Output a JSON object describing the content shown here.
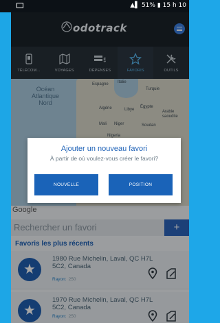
{
  "status_bar": {
    "battery": "51%",
    "time": "15 h 10"
  },
  "app": {
    "name": "odotrack"
  },
  "tabs": [
    {
      "label": "TÉLÉCOM..."
    },
    {
      "label": "VOYAGES"
    },
    {
      "label": "DÉPENSES"
    },
    {
      "label": "FAVORIS"
    },
    {
      "label": "OUTILS"
    }
  ],
  "map": {
    "ocean_label": "Océan\nAtlantique\nNord",
    "labels": {
      "espagne": "Espagne",
      "italie": "Italie",
      "turquie": "Turquie",
      "algerie": "Algérie",
      "libye": "Libye",
      "egypte": "Égypte",
      "arabie": "Arabie\nsaoudite",
      "mali": "Mali",
      "niger": "Niger",
      "soudan": "Soudan",
      "nigeria": "Nigeria"
    },
    "attribution": "Google"
  },
  "dialog": {
    "title": "Ajouter un nouveau favori",
    "subtitle": "À partir de où voulez-vous créer le favori?",
    "button_new": "NOUVELLE",
    "button_position": "POSITION"
  },
  "search": {
    "placeholder": "Rechercher un favori",
    "add_symbol": "+"
  },
  "recent": {
    "title": "Favoris les plus récents",
    "items": [
      {
        "address": "1980 Rue Michelin, Laval, QC H7L 5C2, Canada",
        "radius_label": "Rayon:",
        "radius_value": "250"
      },
      {
        "address": "1970 Rue Michelin, Laval, QC H7L 5C2, Canada",
        "radius_label": "Rayon:",
        "radius_value": "250"
      }
    ]
  },
  "colors": {
    "accent": "#1a63b8",
    "header": "#1b2229",
    "frame": "#1da6e6"
  }
}
